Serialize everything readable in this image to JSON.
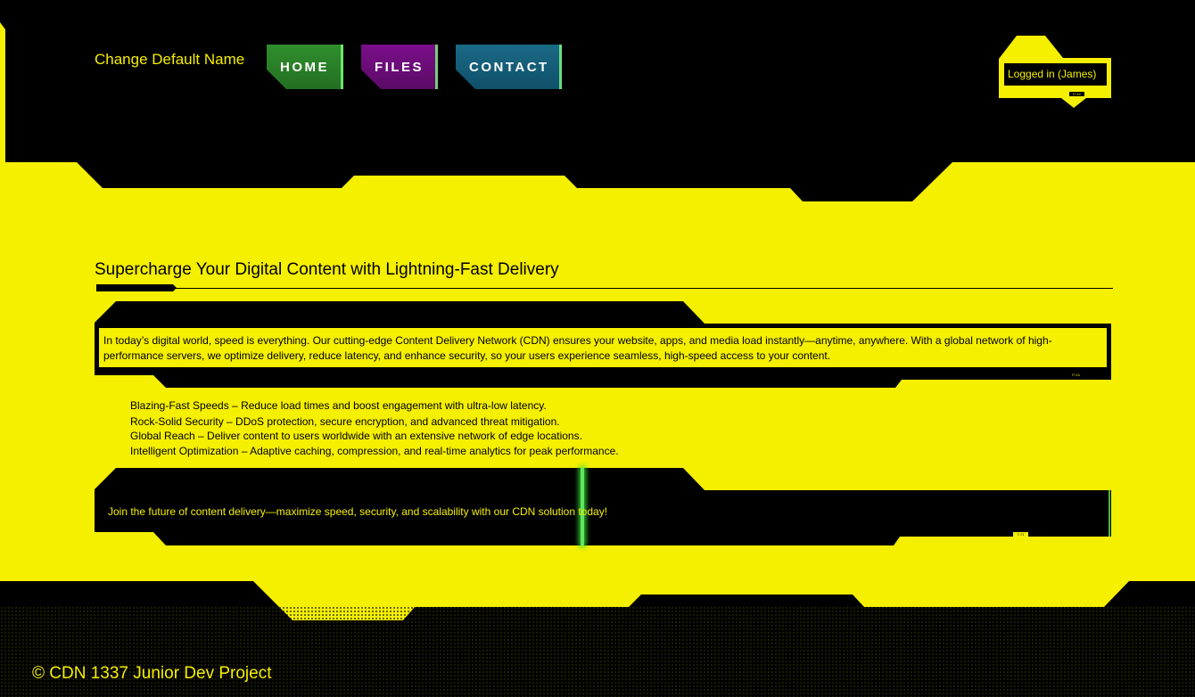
{
  "colors": {
    "accent": "#f5ef00",
    "background": "#000000",
    "home": "#2f8f2c",
    "files": "#7a0f8a",
    "contact": "#1a6a86",
    "glow": "#6aff6a"
  },
  "header": {
    "site_name": "Change Default Name",
    "nav": {
      "home": "HOME",
      "files": "FILES",
      "contact": "CONTACT"
    },
    "login": {
      "label": "Logged in (James)",
      "tag": "P-14"
    }
  },
  "main": {
    "headline": "Supercharge Your Digital Content with Lightning-Fast Delivery",
    "intro": "In today’s digital world, speed is everything. Our cutting-edge Content Delivery Network (CDN) ensures your website, apps, and media load instantly—anytime, anywhere. With a global network of high-performance servers, we optimize delivery, reduce latency, and enhance security, so your users experience seamless, high-speed access to your content.",
    "intro_tag": "P-14",
    "features": [
      "Blazing-Fast Speeds – Reduce load times and boost engagement with ultra-low latency.",
      " Rock-Solid Security – DDoS protection, secure encryption, and advanced threat mitigation.",
      "Global Reach – Deliver content to users worldwide with an extensive network of edge locations.",
      "Intelligent Optimization – Adaptive caching, compression, and real-time analytics for peak performance."
    ],
    "cta": "Join the future of content delivery—maximize speed, security, and scalability with our CDN solution today!",
    "cta_tag": "T-71"
  },
  "footer": {
    "copyright": "© CDN 1337 Junior Dev Project"
  }
}
